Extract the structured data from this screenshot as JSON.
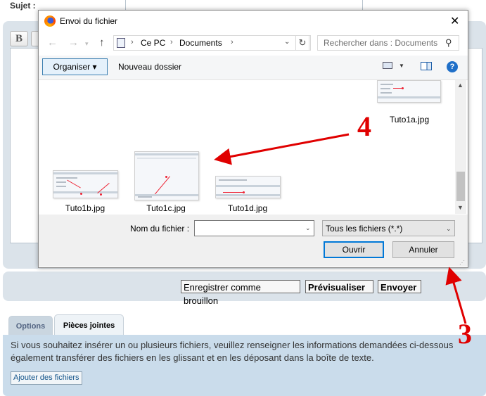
{
  "page": {
    "subject_label": "Sujet :",
    "bold_button": "B",
    "buttons": {
      "draft": "Enregistrer comme brouillon",
      "preview": "Prévisualiser",
      "send": "Envoyer"
    },
    "tabs": [
      {
        "label": "Options"
      },
      {
        "label": "Pièces jointes"
      }
    ],
    "attach_text_line1": "Si vous souhaitez insérer un ou plusieurs fichiers, veuillez renseigner les informations demandées ci-dessous",
    "attach_text_line2": "également transférer des fichiers en les glissant et en les déposant dans la boîte de texte.",
    "add_files_button": "Ajouter des fichiers"
  },
  "dialog": {
    "title": "Envoi du fichier",
    "close": "✕",
    "nav": {
      "back": "←",
      "forward": "→",
      "recent": "▾",
      "up": "↑",
      "breadcrumb": [
        "Ce PC",
        "Documents"
      ],
      "separator": "›",
      "address_dropdown": "⌄",
      "refresh": "↻",
      "search_placeholder": "Rechercher dans : Documents"
    },
    "toolbar": {
      "organize": "Organiser ▾",
      "new_folder": "Nouveau dossier",
      "view_caret": "▼",
      "help": "?"
    },
    "files": [
      {
        "name": "Tuto1a.jpg"
      },
      {
        "name": "Tuto1b.jpg"
      },
      {
        "name": "Tuto1c.jpg"
      },
      {
        "name": "Tuto1d.jpg"
      }
    ],
    "scroll": {
      "up": "▲",
      "down": "▼"
    },
    "bottom": {
      "filename_label": "Nom du fichier :",
      "filename_value": "",
      "filename_drop": "⌄",
      "filetype": "Tous les fichiers (*.*)",
      "filetype_drop": "⌄",
      "open": "Ouvrir",
      "cancel": "Annuler"
    }
  },
  "annotations": [
    {
      "label": "4",
      "color": "#e00000"
    },
    {
      "label": "3",
      "color": "#e00000"
    }
  ]
}
